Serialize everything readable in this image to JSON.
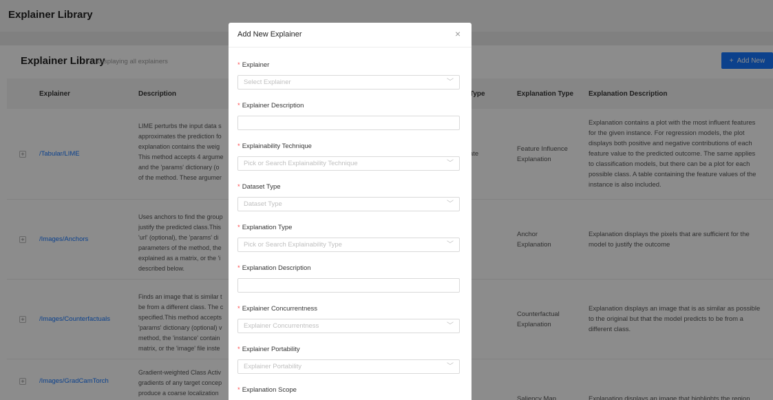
{
  "page": {
    "title": "Explainer Library"
  },
  "card": {
    "title": "Explainer Library",
    "subtitle": "Displaying all explainers",
    "add_button": "Add New",
    "add_icon": "+"
  },
  "table": {
    "headers": {
      "explainer": "Explainer",
      "description": "Description",
      "type": "Type",
      "explanation_type": "Explanation Type",
      "explanation_description": "Explanation Description"
    },
    "rows": [
      {
        "expand": "+",
        "explainer": "/Tabular/LIME",
        "description": [
          "LIME perturbs the input data s",
          "approximates the prediction fo",
          "explanation contains the weig",
          "This method accepts 4 argume",
          "and the 'params' dictionary (o",
          "of the method. These argumer"
        ],
        "type": "ate",
        "explanation_type": [
          "Feature Influence",
          "Explanation"
        ],
        "explanation_description": [
          "Explanation contains a plot with the most influent features",
          "for the given instance. For regression models, the plot",
          "displays both positive and negative contributions of each",
          "feature value to the predicted outcome. The same applies",
          "to classification models, but there can be a plot for each",
          "possible class. A table containing the feature values of the",
          "instance is also included."
        ]
      },
      {
        "expand": "+",
        "explainer": "/Images/Anchors",
        "description": [
          "Uses anchors to find the group",
          "justify the predicted class.This",
          "'url' (optional), the 'params' di",
          "parameters of the method, the",
          "explained as a matrix, or the 'i",
          "described below."
        ],
        "type": "",
        "explanation_type": [
          "Anchor",
          "Explanation"
        ],
        "explanation_description": [
          "Explanation displays the pixels that are sufficient for the",
          "model to justify the outcome"
        ]
      },
      {
        "expand": "+",
        "explainer": "/Images/Counterfactuals",
        "description": [
          "Finds an image that is similar t",
          "be from a different class. The c",
          "specified.This method accepts",
          "'params' dictionary (optional) v",
          "method, the 'instance' contain",
          "matrix, or the 'image' file inste"
        ],
        "type": "",
        "explanation_type": [
          "Counterfactual",
          "Explanation"
        ],
        "explanation_description": [
          "Explanation displays an image that is as similar as possible",
          "to the original but that the model predicts to be from a",
          "different class."
        ]
      },
      {
        "expand": "+",
        "explainer": "/Images/GradCamTorch",
        "description": [
          "Gradient-weighted Class Activ",
          "gradients of any target concep",
          "produce a coarse localization"
        ],
        "type": "",
        "explanation_type": [
          "Saliency Map"
        ],
        "explanation_description": [
          "Explanation displays an image that highlights the region"
        ]
      }
    ]
  },
  "modal": {
    "title": "Add New Explainer",
    "close_icon": "×",
    "required_mark": "*",
    "chevron_icon": "﹀",
    "fields": [
      {
        "label": "Explainer",
        "placeholder": "Select Explainer",
        "kind": "select"
      },
      {
        "label": "Explainer Description",
        "placeholder": "",
        "kind": "input"
      },
      {
        "label": "Explainability Technique",
        "placeholder": "Pick or Search Explainability Technique",
        "kind": "select"
      },
      {
        "label": "Dataset Type",
        "placeholder": "Dataset Type",
        "kind": "select"
      },
      {
        "label": "Explanation Type",
        "placeholder": "Pick or Search Explainability Type",
        "kind": "select"
      },
      {
        "label": "Explanation Description",
        "placeholder": "",
        "kind": "input"
      },
      {
        "label": "Explainer Concurrentness",
        "placeholder": "Explainer Concurrentness",
        "kind": "select"
      },
      {
        "label": "Explainer Portability",
        "placeholder": "Explainer Portability",
        "kind": "select"
      },
      {
        "label": "Explanation Scope",
        "placeholder": "",
        "kind": "select"
      }
    ]
  }
}
